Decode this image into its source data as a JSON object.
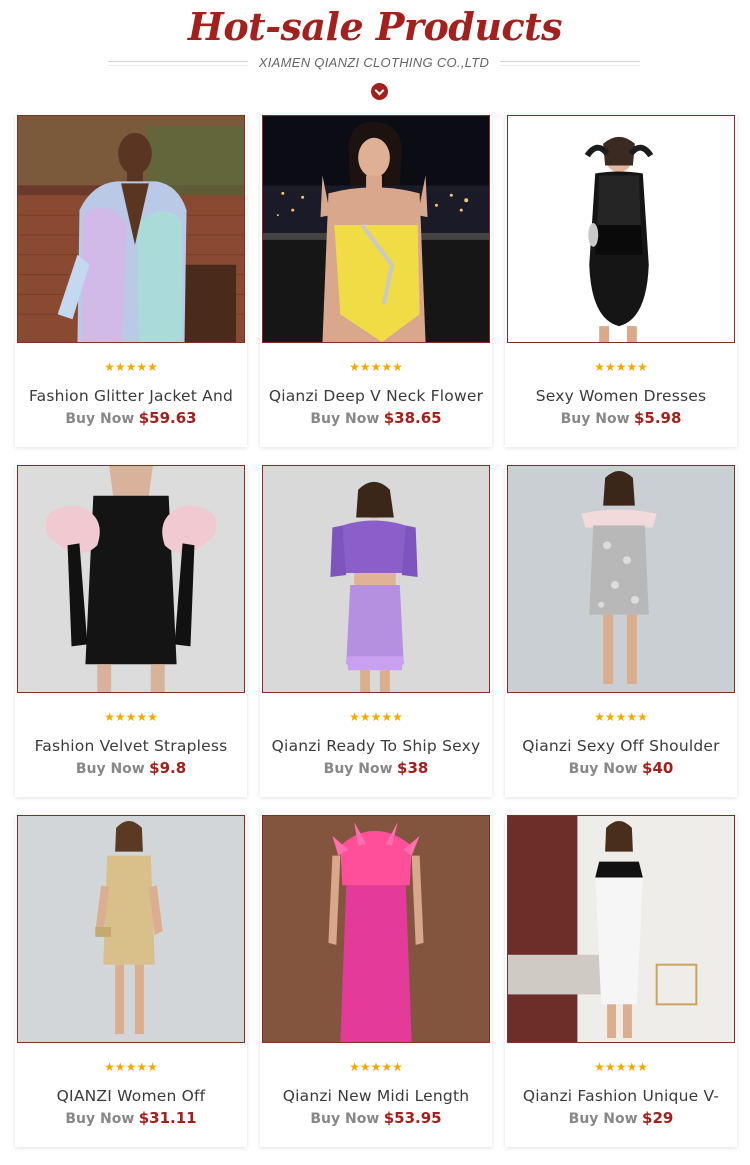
{
  "header": {
    "title": "Hot-sale Products",
    "subtitle": "XIAMEN QIANZI CLOTHING CO.,LTD"
  },
  "colors": {
    "accent": "#a3201c",
    "star": "#f2a900",
    "buy_label": "#888888"
  },
  "rating_stars": "★★★★★",
  "buy_label": "Buy Now",
  "products": [
    {
      "name": "Fashion Glitter Jacket And",
      "price": "$59.63"
    },
    {
      "name": "Qianzi Deep V Neck Flower",
      "price": "$38.65"
    },
    {
      "name": "Sexy Women Dresses",
      "price": "$5.98"
    },
    {
      "name": "Fashion Velvet Strapless",
      "price": "$9.8"
    },
    {
      "name": "Qianzi Ready To Ship Sexy",
      "price": "$38"
    },
    {
      "name": "Qianzi Sexy Off Shoulder",
      "price": "$40"
    },
    {
      "name": "QIANZI Women Off",
      "price": "$31.11"
    },
    {
      "name": "Qianzi New Midi Length",
      "price": "$53.95"
    },
    {
      "name": "Qianzi Fashion Unique V-",
      "price": "$29"
    }
  ]
}
